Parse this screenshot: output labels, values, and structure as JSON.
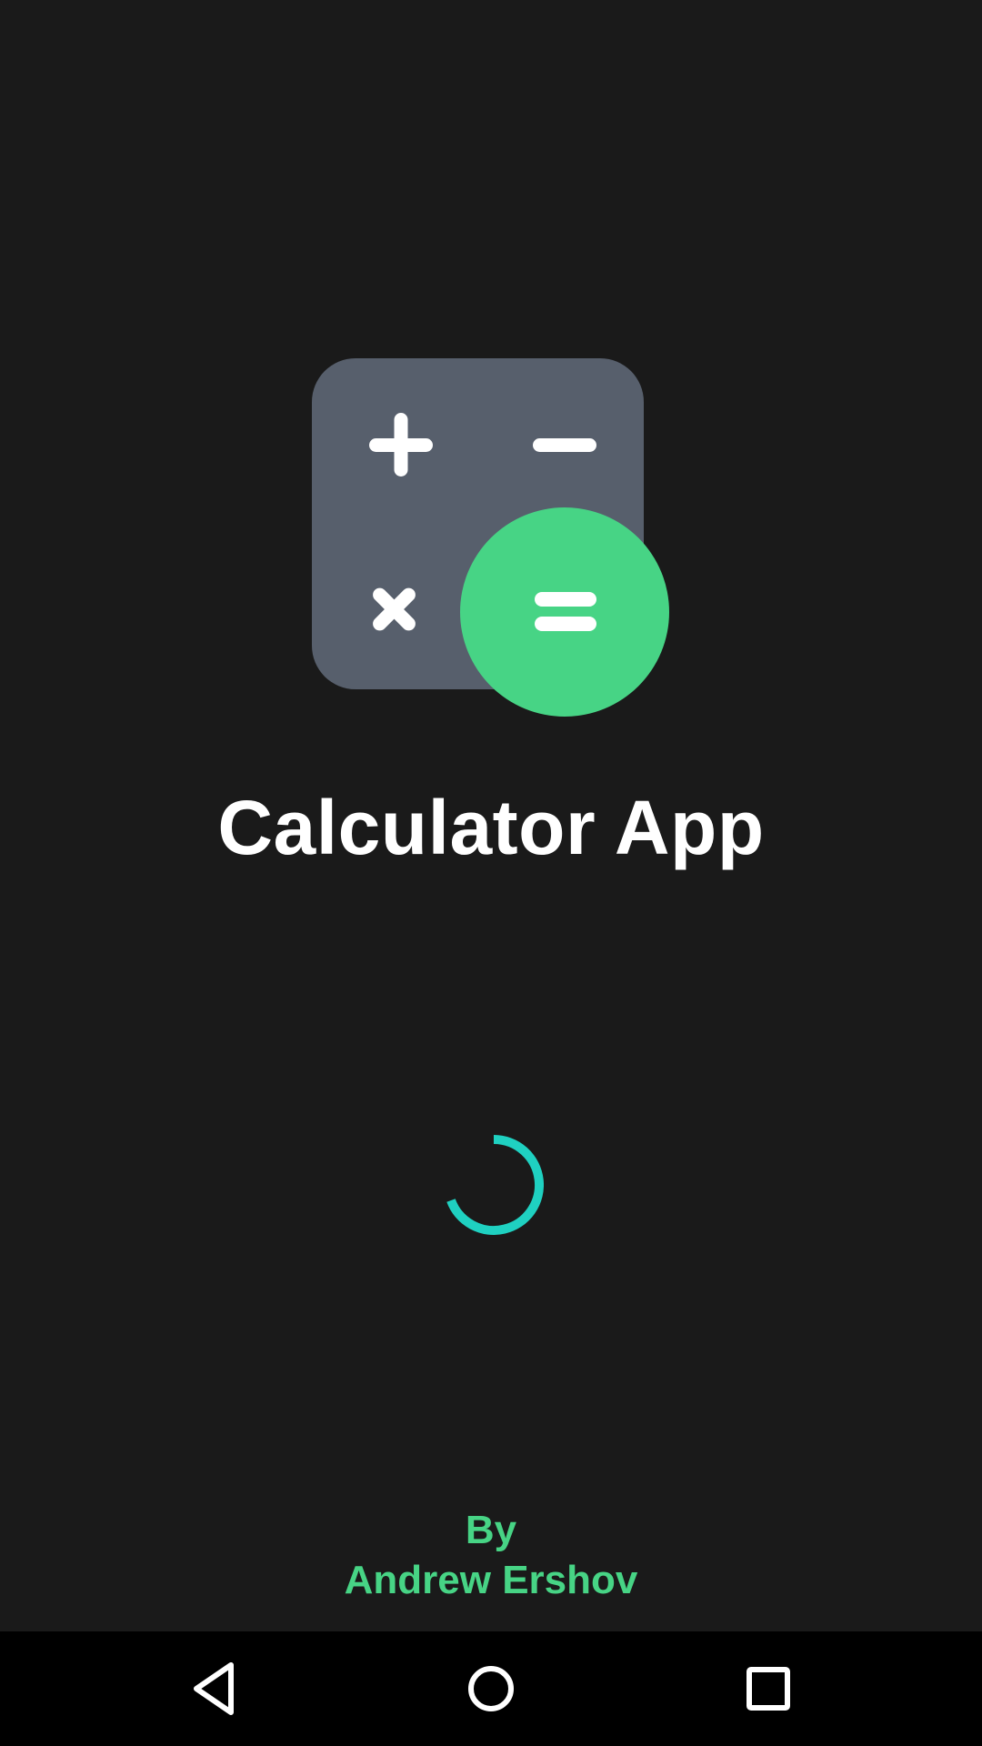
{
  "app": {
    "title": "Calculator App",
    "icon": "calculator-app-icon"
  },
  "loading": {
    "indicator": "spinner",
    "color": "#1fd1c1"
  },
  "author": {
    "line1": "By",
    "line2": "Andrew Ershov"
  },
  "colors": {
    "background": "#1a1a1a",
    "accent_green": "#47d485",
    "icon_panel": "#575f6c",
    "navbar": "#000000"
  },
  "navbar": {
    "buttons": [
      {
        "icon": "back-triangle-icon"
      },
      {
        "icon": "home-circle-icon"
      },
      {
        "icon": "recents-square-icon"
      }
    ]
  }
}
